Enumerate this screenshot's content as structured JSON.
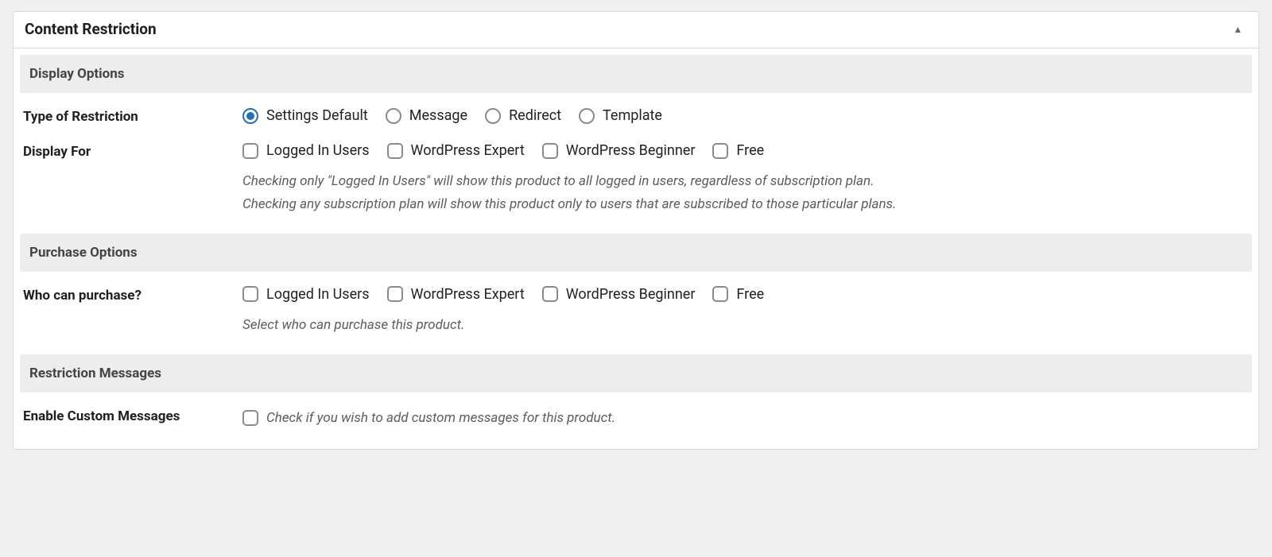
{
  "panel": {
    "title": "Content Restriction"
  },
  "sections": {
    "display_options": {
      "heading": "Display Options"
    },
    "purchase_options": {
      "heading": "Purchase Options"
    },
    "restriction_messages": {
      "heading": "Restriction Messages"
    }
  },
  "type_of_restriction": {
    "label": "Type of Restriction",
    "options": [
      {
        "id": "settings-default",
        "label": "Settings Default",
        "checked": true
      },
      {
        "id": "message",
        "label": "Message",
        "checked": false
      },
      {
        "id": "redirect",
        "label": "Redirect",
        "checked": false
      },
      {
        "id": "template",
        "label": "Template",
        "checked": false
      }
    ]
  },
  "display_for": {
    "label": "Display For",
    "options": [
      {
        "id": "logged-in-users",
        "label": "Logged In Users",
        "checked": false
      },
      {
        "id": "wordpress-expert",
        "label": "WordPress Expert",
        "checked": false
      },
      {
        "id": "wordpress-beginner",
        "label": "WordPress Beginner",
        "checked": false
      },
      {
        "id": "free",
        "label": "Free",
        "checked": false
      }
    ],
    "help1": "Checking only \"Logged In Users\" will show this product to all logged in users, regardless of subscription plan.",
    "help2": "Checking any subscription plan will show this product only to users that are subscribed to those particular plans."
  },
  "who_can_purchase": {
    "label": "Who can purchase?",
    "options": [
      {
        "id": "logged-in-users",
        "label": "Logged In Users",
        "checked": false
      },
      {
        "id": "wordpress-expert",
        "label": "WordPress Expert",
        "checked": false
      },
      {
        "id": "wordpress-beginner",
        "label": "WordPress Beginner",
        "checked": false
      },
      {
        "id": "free",
        "label": "Free",
        "checked": false
      }
    ],
    "help": "Select who can purchase this product."
  },
  "enable_custom_messages": {
    "label": "Enable Custom Messages",
    "checked": false,
    "help": "Check if you wish to add custom messages for this product."
  }
}
